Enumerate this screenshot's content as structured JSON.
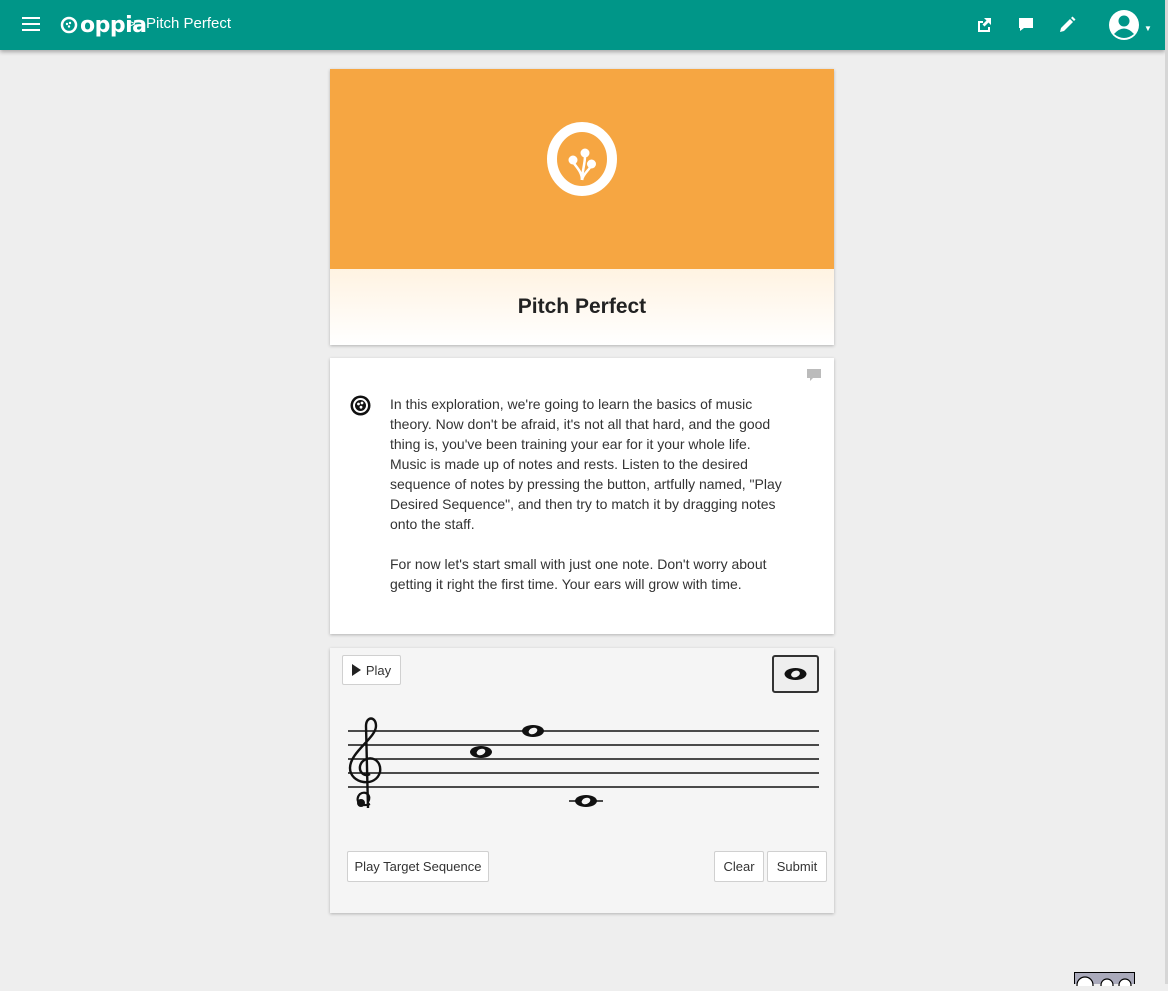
{
  "nav": {
    "logo_text": "oppia",
    "breadcrumb_separator": ">",
    "exploration_title": "Pitch Perfect",
    "accent_color": "#009688",
    "icons": [
      "menu-icon",
      "share-icon",
      "feedback-icon",
      "edit-icon",
      "user-avatar-icon"
    ]
  },
  "hero": {
    "banner_color": "#f6a642",
    "title": "Pitch Perfect"
  },
  "content": {
    "paragraphs": [
      "In this exploration, we're going to learn the basics of music theory. Now don't be afraid, it's not all that hard, and the good thing is, you've been training your ear for it your whole life. Music is made up of notes and rests. Listen to the desired sequence of notes by pressing the button, artfully named, \"Play Desired Sequence\", and then try to match it by dragging notes onto the staff.",
      "For now let's start small with just one note. Don't worry about getting it right the first time. Your ears will grow with time."
    ]
  },
  "music": {
    "play_label": "Play",
    "play_target_label": "Play Target Sequence",
    "clear_label": "Clear",
    "submit_label": "Submit",
    "notes_on_staff": 3,
    "palette_icon": "whole-note-icon"
  }
}
